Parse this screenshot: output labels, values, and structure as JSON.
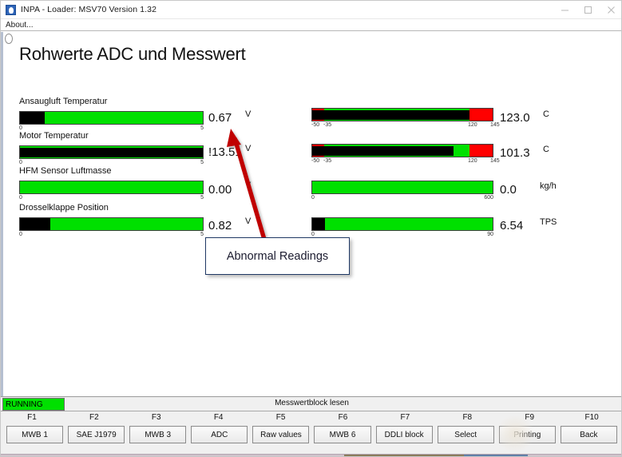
{
  "window": {
    "title": "INPA - Loader: MSV70 Version 1.32",
    "app_icon": "inpa-app-icon",
    "controls": {
      "minimize": "minimize-icon",
      "maximize": "maximize-icon",
      "close": "close-icon"
    }
  },
  "menu": {
    "items": [
      {
        "label": "About..."
      }
    ]
  },
  "main": {
    "heading": "Rohwerte ADC und Messwert",
    "left_gauges": [
      {
        "label": "Ansaugluft Temperatur",
        "value": "0.67",
        "unit": "V",
        "min_tick": "0",
        "max_tick": "5",
        "fill_percent": 13.4,
        "abnormal": false
      },
      {
        "label": "Motor Temperatur",
        "value": "!13.51",
        "unit": "V",
        "min_tick": "0",
        "max_tick": "5",
        "fill_percent": 100,
        "abnormal": true
      },
      {
        "label": "HFM Sensor Luftmasse",
        "value": "0.00",
        "unit": "V",
        "min_tick": "0",
        "max_tick": "5",
        "fill_percent": 0,
        "abnormal": false
      },
      {
        "label": "Drosselklappe Position",
        "value": "0.82",
        "unit": "V",
        "min_tick": "0",
        "max_tick": "5",
        "fill_percent": 16.4,
        "abnormal": false
      }
    ],
    "right_gauges": [
      {
        "value": "123.0",
        "unit": "C",
        "ticks": [
          "-50",
          "-35",
          "120",
          "145"
        ],
        "fill_percent": 87.0,
        "low_zone_percent": 6.5,
        "high_zone_start_percent": 87.0,
        "has_zones": true
      },
      {
        "value": "101.3",
        "unit": "C",
        "ticks": [
          "-50",
          "-35",
          "120",
          "145"
        ],
        "fill_percent": 78.5,
        "low_zone_percent": 6.5,
        "high_zone_start_percent": 87.0,
        "has_zones": true
      },
      {
        "value": "0.0",
        "unit": "kg/h",
        "ticks": [
          "0",
          "600"
        ],
        "fill_percent": 0,
        "has_zones": false
      },
      {
        "value": "6.54",
        "unit": "TPS",
        "ticks": [
          "0",
          "90"
        ],
        "fill_percent": 7.3,
        "has_zones": false
      }
    ],
    "annotation": {
      "text": "Abnormal Readings",
      "arrow_color": "#c00000",
      "border_color": "#1f3864"
    }
  },
  "statusbar": {
    "run_state": "RUNNING",
    "message": "Messwertblock lesen",
    "run_state_color": "#00e000"
  },
  "function_keys": [
    {
      "key": "F1",
      "label": "MWB 1"
    },
    {
      "key": "F2",
      "label": "SAE J1979"
    },
    {
      "key": "F3",
      "label": "MWB 3"
    },
    {
      "key": "F4",
      "label": "ADC"
    },
    {
      "key": "F5",
      "label": "Raw values"
    },
    {
      "key": "F6",
      "label": "MWB 6"
    },
    {
      "key": "F7",
      "label": "DDLI block"
    },
    {
      "key": "F8",
      "label": "Select"
    },
    {
      "key": "F9",
      "label": "Printing"
    },
    {
      "key": "F10",
      "label": "Back"
    }
  ]
}
